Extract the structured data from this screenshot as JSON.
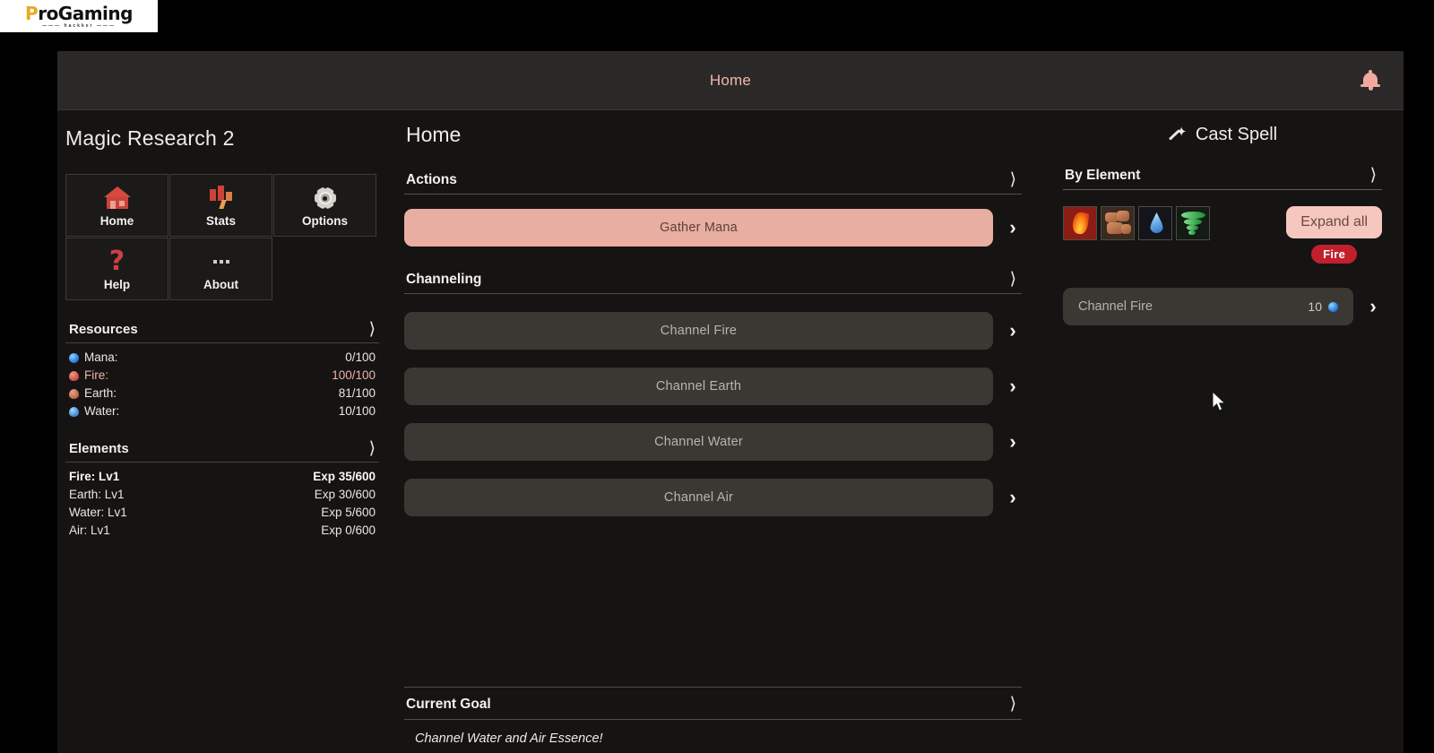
{
  "browser": {
    "logo_main_first": "P",
    "logo_main_rest": "roGaming",
    "logo_sub": "——— hackker ———"
  },
  "topnav": {
    "title": "Home",
    "bell_icon": "bell-icon"
  },
  "sidebar": {
    "game_title": "Magic Research 2",
    "nav_buttons": [
      {
        "label": "Home",
        "icon": "home-icon"
      },
      {
        "label": "Stats",
        "icon": "stats-icon"
      },
      {
        "label": "Options",
        "icon": "gear-icon"
      },
      {
        "label": "Help",
        "icon": "question-mark-icon"
      },
      {
        "label": "About",
        "icon": "ellipsis-icon"
      }
    ],
    "resources": {
      "title": "Resources",
      "rows": [
        {
          "label": "Mana:",
          "value": "0/100",
          "orb": "mana"
        },
        {
          "label": "Fire:",
          "value": "100/100",
          "orb": "fire"
        },
        {
          "label": "Earth:",
          "value": "81/100",
          "orb": "earth"
        },
        {
          "label": "Water:",
          "value": "10/100",
          "orb": "water"
        }
      ]
    },
    "elements": {
      "title": "Elements",
      "rows": [
        {
          "label": "Fire: Lv1",
          "value": "Exp 35/600"
        },
        {
          "label": "Earth: Lv1",
          "value": "Exp 30/600"
        },
        {
          "label": "Water: Lv1",
          "value": "Exp 5/600"
        },
        {
          "label": "Air: Lv1",
          "value": "Exp 0/600"
        }
      ]
    }
  },
  "main": {
    "page_title": "Home",
    "actions": {
      "title": "Actions",
      "items": [
        {
          "label": "Gather Mana"
        }
      ]
    },
    "channeling": {
      "title": "Channeling",
      "items": [
        {
          "label": "Channel Fire"
        },
        {
          "label": "Channel Earth"
        },
        {
          "label": "Channel Water"
        },
        {
          "label": "Channel Air"
        }
      ]
    },
    "goal": {
      "title": "Current Goal",
      "text": "Channel Water and Air Essence!"
    }
  },
  "right": {
    "cast_spell_label": "Cast Spell",
    "by_element": {
      "title": "By Element",
      "tiles": [
        {
          "name": "fire"
        },
        {
          "name": "earth"
        },
        {
          "name": "water"
        },
        {
          "name": "air"
        }
      ],
      "expand_all_label": "Expand all",
      "selected_badge": "Fire"
    },
    "spells": [
      {
        "label": "Channel Fire",
        "cost": "10",
        "cost_orb": "mana"
      }
    ]
  },
  "colors": {
    "accent_primary": "#e8aea2",
    "accent_light": "#f6c7bf",
    "badge_red": "#c21f2e",
    "nav_title": "#f0b7ad",
    "app_bg": "#151413",
    "panel_bg": "#2b2927"
  }
}
